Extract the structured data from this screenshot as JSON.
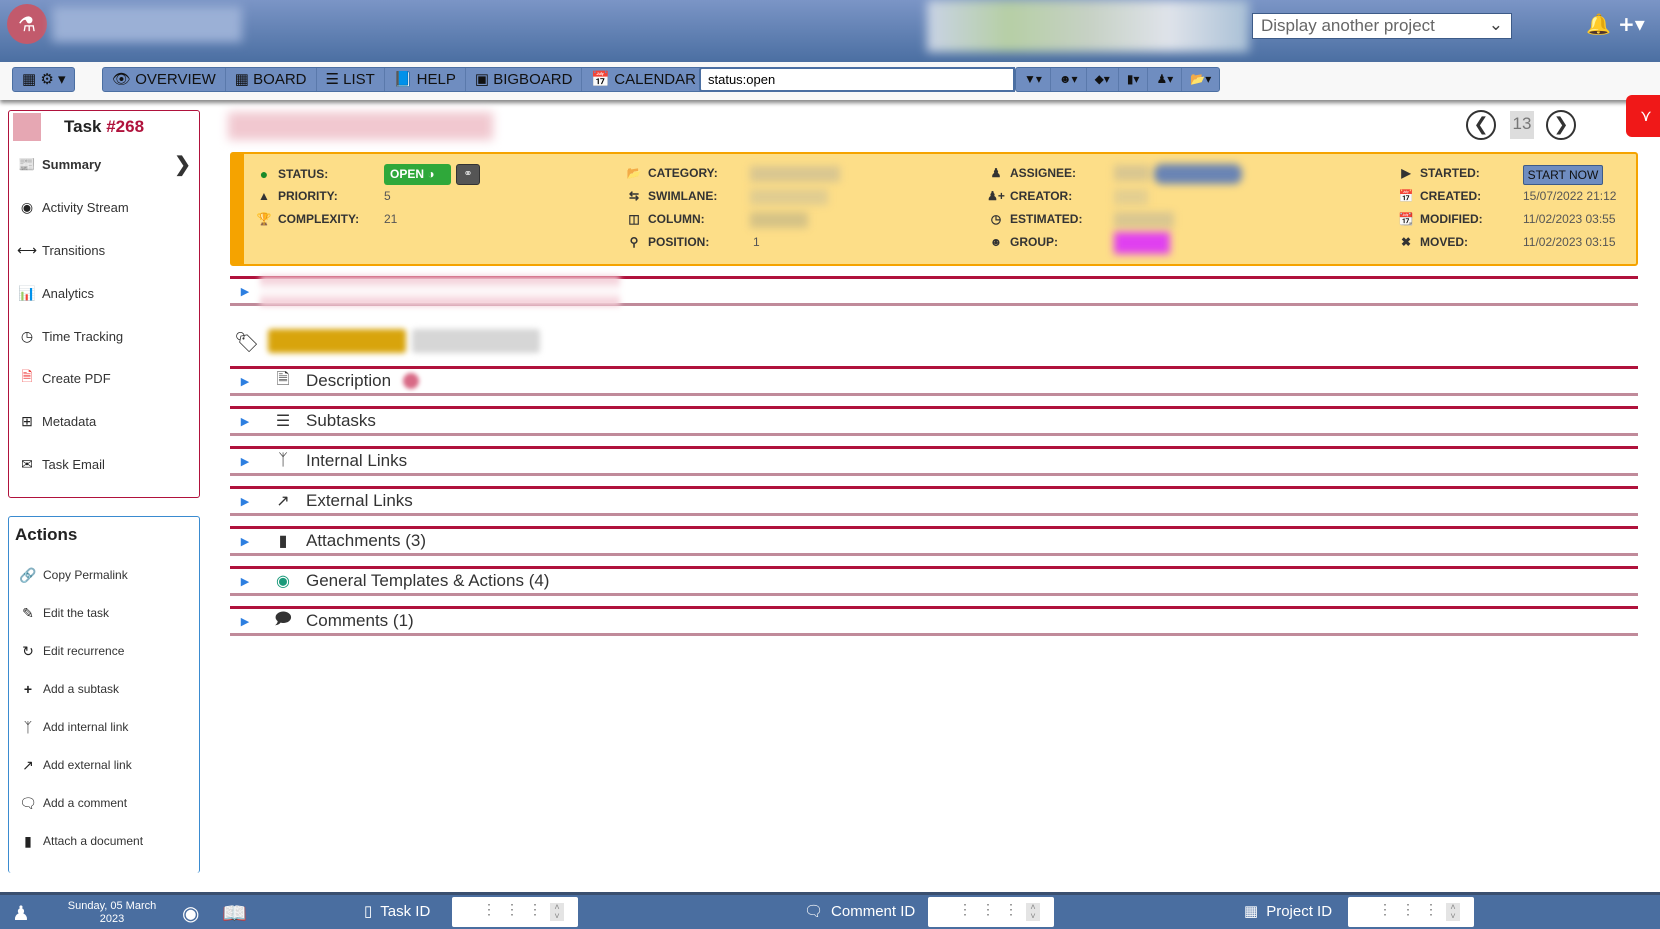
{
  "header": {
    "project_select_placeholder": "Display another project"
  },
  "toolbar": {
    "views": [
      {
        "label": "OVERVIEW",
        "icon": "eye-icon"
      },
      {
        "label": "BOARD",
        "icon": "grid-icon"
      },
      {
        "label": "LIST",
        "icon": "list-icon"
      },
      {
        "label": "HELP",
        "icon": "book-icon"
      },
      {
        "label": "BIGBOARD",
        "icon": "bigboard-icon"
      },
      {
        "label": "CALENDAR",
        "icon": "calendar-icon"
      }
    ],
    "search_value": "status:open"
  },
  "task": {
    "title_prefix": "Task ",
    "number": "#268"
  },
  "sidebar": {
    "items": [
      {
        "label": "Summary",
        "icon": "newspaper-icon"
      },
      {
        "label": "Activity Stream",
        "icon": "dashboard-icon"
      },
      {
        "label": "Transitions",
        "icon": "arrows-h-icon"
      },
      {
        "label": "Analytics",
        "icon": "bar-chart-icon"
      },
      {
        "label": "Time Tracking",
        "icon": "clock-icon"
      },
      {
        "label": "Create PDF",
        "icon": "pdf-icon"
      },
      {
        "label": "Metadata",
        "icon": "plus-square-icon"
      },
      {
        "label": "Task Email",
        "icon": "envelope-icon"
      }
    ],
    "actions_title": "Actions",
    "actions": [
      {
        "label": "Copy Permalink",
        "icon": "link-icon"
      },
      {
        "label": "Edit the task",
        "icon": "edit-icon"
      },
      {
        "label": "Edit recurrence",
        "icon": "refresh-icon"
      },
      {
        "label": "Add a subtask",
        "icon": "plus-icon"
      },
      {
        "label": "Add internal link",
        "icon": "code-fork-icon"
      },
      {
        "label": "Add external link",
        "icon": "external-link-icon"
      },
      {
        "label": "Add a comment",
        "icon": "comment-icon"
      },
      {
        "label": "Attach a document",
        "icon": "file-icon"
      }
    ]
  },
  "pager": {
    "count": "13"
  },
  "info": {
    "status_label": "STATUS:",
    "status_value": "OPEN",
    "priority_label": "PRIORITY:",
    "priority_value": "5",
    "complexity_label": "COMPLEXITY:",
    "complexity_value": "21",
    "category_label": "CATEGORY:",
    "swimlane_label": "SWIMLANE:",
    "column_label": "COLUMN:",
    "position_label": "POSITION:",
    "position_value": "1",
    "assignee_label": "ASSIGNEE:",
    "creator_label": "CREATOR:",
    "estimated_label": "ESTIMATED:",
    "group_label": "GROUP:",
    "started_label": "STARTED:",
    "start_now": "START NOW",
    "created_label": "CREATED:",
    "created_value": "15/07/2022 21:12",
    "modified_label": "MODIFIED:",
    "modified_value": "11/02/2023 03:55",
    "moved_label": "MOVED:",
    "moved_value": "11/02/2023 03:15",
    "status_color": "#2fa83a",
    "accent_color": "#f5a300"
  },
  "sections": [
    {
      "label": "Description",
      "icon": "file-text-icon"
    },
    {
      "label": "Subtasks",
      "icon": "tasks-icon"
    },
    {
      "label": "Internal Links",
      "icon": "code-fork-icon"
    },
    {
      "label": "External Links",
      "icon": "external-link-icon"
    },
    {
      "label": "Attachments (3)",
      "icon": "file-icon"
    },
    {
      "label": "General Templates & Actions (4)",
      "icon": "templates-icon"
    },
    {
      "label": "Comments (1)",
      "icon": "comments-icon"
    }
  ],
  "footer": {
    "date_line1": "Sunday, 05 March",
    "date_line2": "2023",
    "task_id_label": "Task ID",
    "comment_id_label": "Comment ID",
    "project_id_label": "Project ID"
  }
}
